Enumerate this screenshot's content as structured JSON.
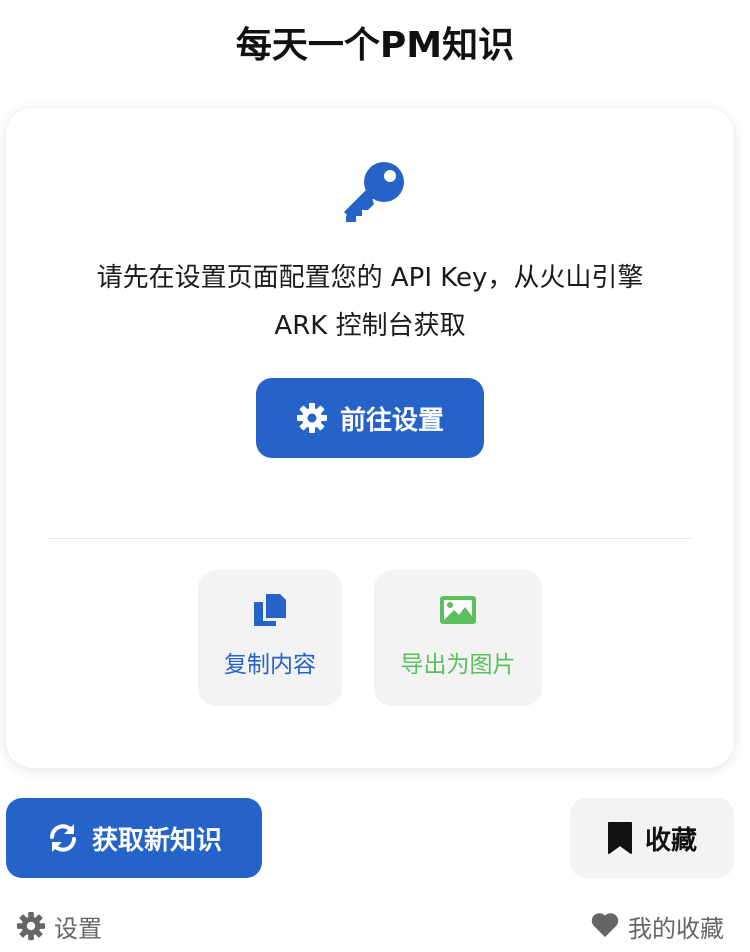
{
  "header": {
    "title": "每天一个PM知识"
  },
  "card": {
    "icon": "key-icon",
    "message": "请先在设置页面配置您的 API Key，从火山引擎 ARK 控制台获取",
    "goto_settings_label": "前往设置",
    "actions": [
      {
        "icon": "copy-icon",
        "label": "复制内容"
      },
      {
        "icon": "image-icon",
        "label": "导出为图片"
      }
    ]
  },
  "bottom_bar": {
    "fetch_label": "获取新知识",
    "fetch_icon": "refresh-icon",
    "favorite_label": "收藏",
    "favorite_icon": "bookmark-icon"
  },
  "footer": {
    "settings_label": "设置",
    "settings_icon": "gear-icon",
    "favorites_label": "我的收藏",
    "favorites_icon": "heart-icon"
  },
  "colors": {
    "primary": "#2563c9",
    "success": "#5bbf5b",
    "tile_bg": "#f3f3f6",
    "muted_text": "#666666"
  }
}
